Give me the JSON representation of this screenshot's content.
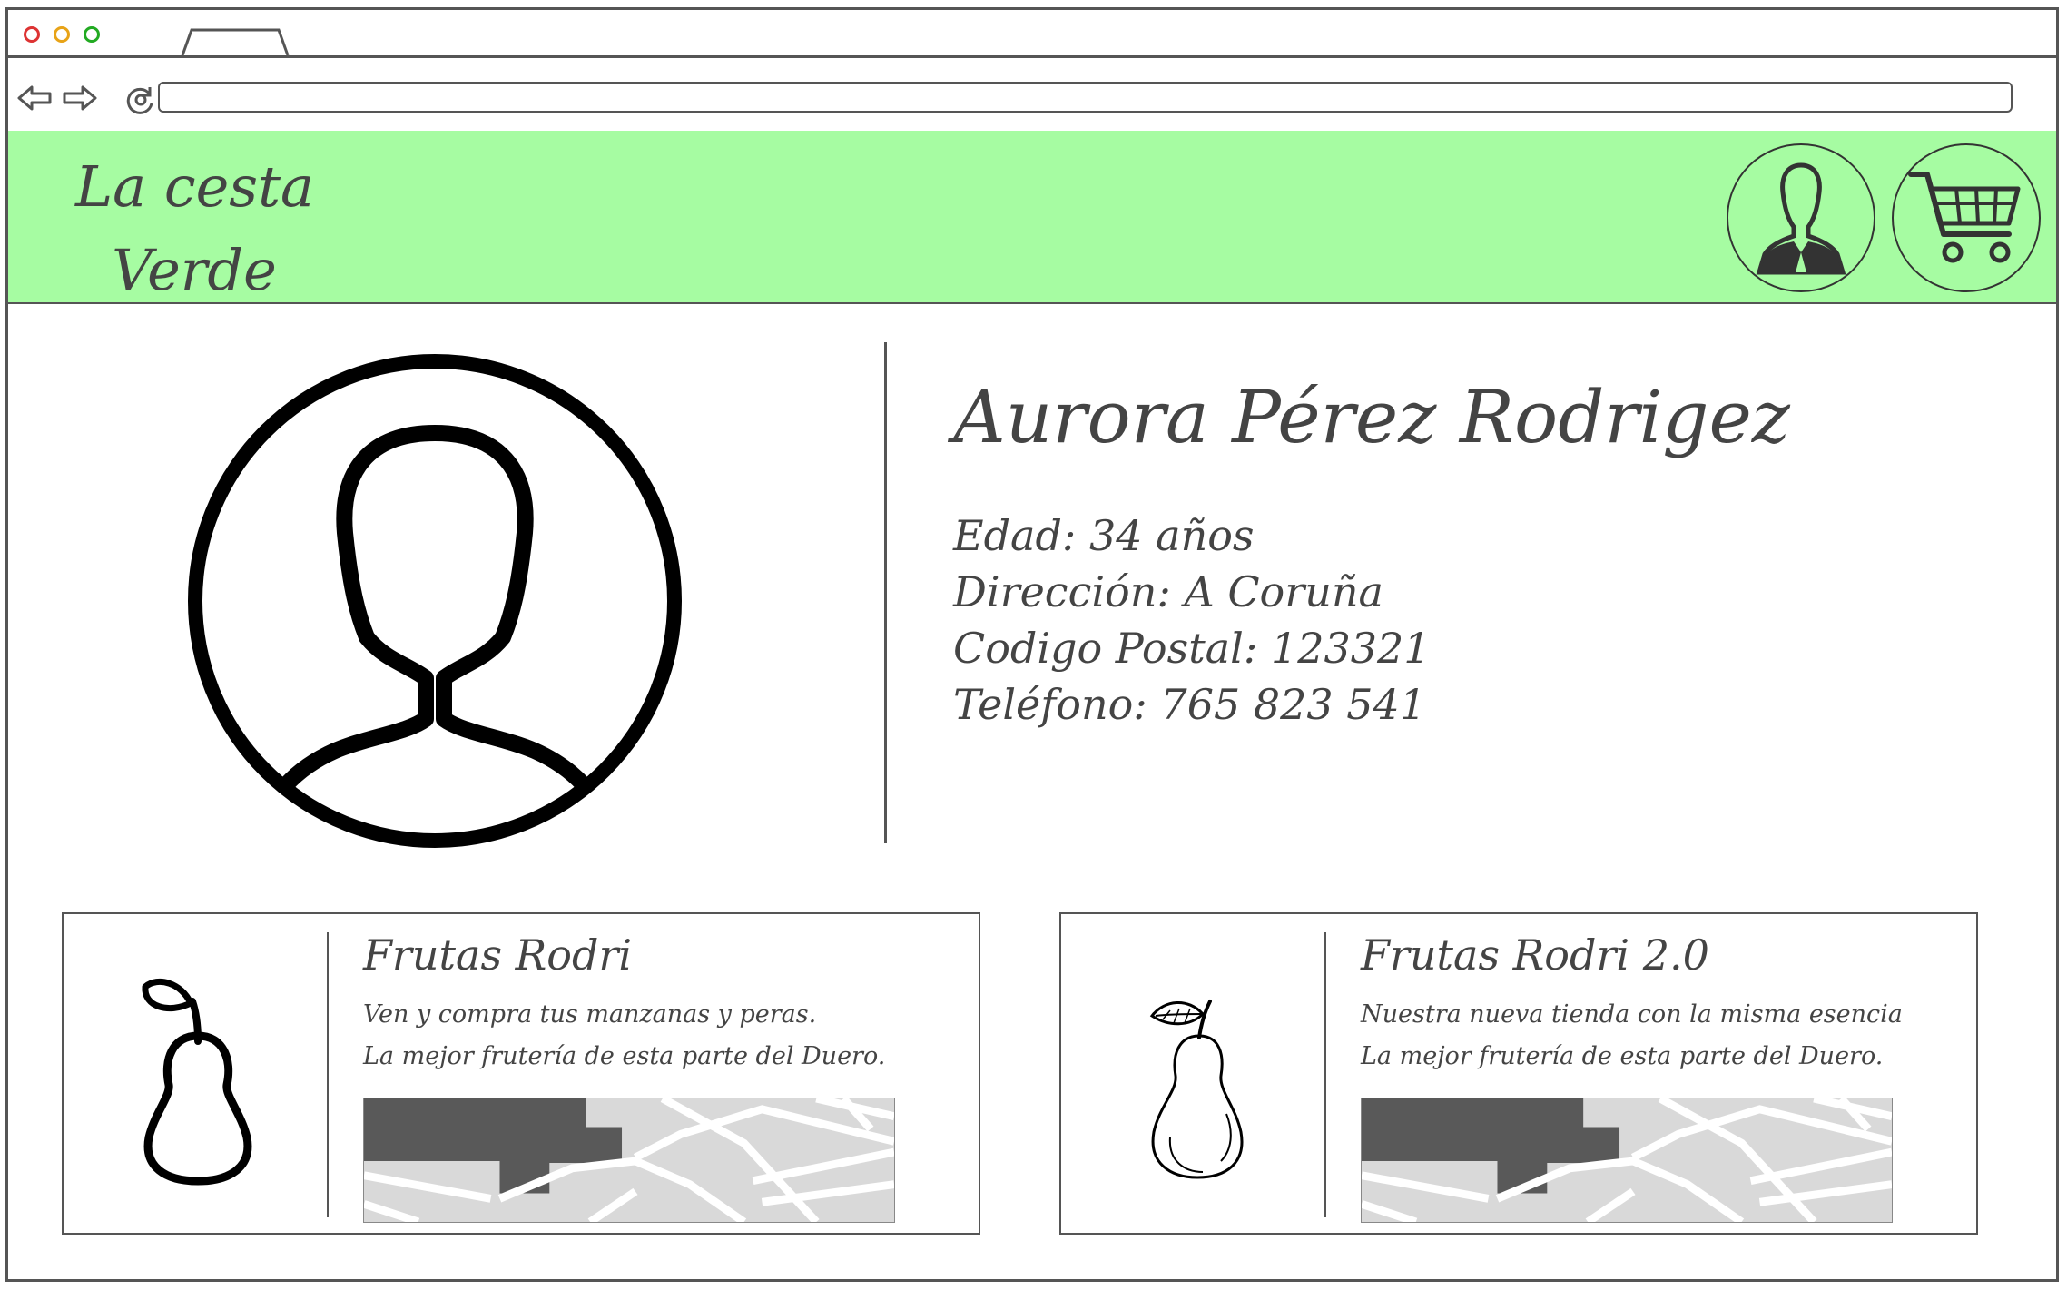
{
  "header": {
    "brand_line1": "La cesta",
    "brand_line2": "Verde"
  },
  "colors": {
    "header_bg": "#a6fca2",
    "text": "#444444"
  },
  "profile": {
    "name": "Aurora Pérez Rodrigez",
    "details": [
      "Edad: 34 años",
      "Dirección: A Coruña",
      "Codigo Postal: 123321",
      "Teléfono: 765 823 541"
    ]
  },
  "stores": [
    {
      "title": "Frutas Rodri",
      "desc_line1": "Ven y compra tus manzanas y peras.",
      "desc_line2": "La mejor frutería de esta parte del Duero."
    },
    {
      "title": "Frutas Rodri 2.0",
      "desc_line1": "Nuestra nueva tienda con la misma esencia",
      "desc_line2": "La mejor frutería de esta parte del Duero."
    }
  ]
}
